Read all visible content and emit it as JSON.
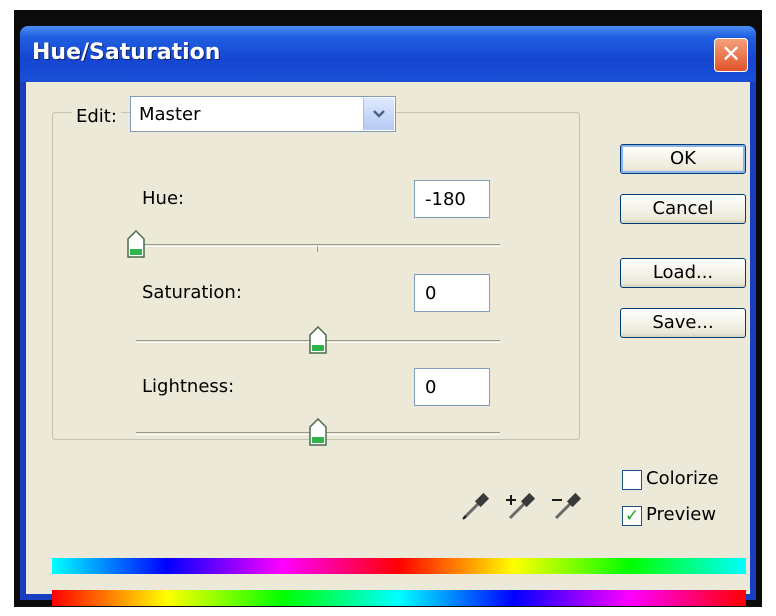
{
  "window": {
    "title": "Hue/Saturation",
    "close_glyph": "✕"
  },
  "edit": {
    "label": "Edit:",
    "value": "Master",
    "arrow_icon": "chevron-down-icon"
  },
  "params": {
    "hue": {
      "label": "Hue:",
      "value": "-180",
      "level": 0.0
    },
    "saturation": {
      "label": "Saturation:",
      "value": "0",
      "level": 0.5
    },
    "lightness": {
      "label": "Lightness:",
      "value": "0",
      "level": 0.5
    }
  },
  "buttons": {
    "ok": "OK",
    "cancel": "Cancel",
    "load": "Load...",
    "save": "Save..."
  },
  "checkboxes": {
    "colorize": {
      "label": "Colorize",
      "checked": false
    },
    "preview": {
      "label": "Preview",
      "checked": true,
      "check_glyph": "✓"
    }
  },
  "icons": [
    "eyedropper-icon",
    "eyedropper-plus-icon",
    "eyedropper-minus-icon"
  ],
  "colors": {
    "title_bar": "#1a4fd6",
    "dialog_bg": "#ece9d8",
    "close_button": "#e1542a"
  }
}
